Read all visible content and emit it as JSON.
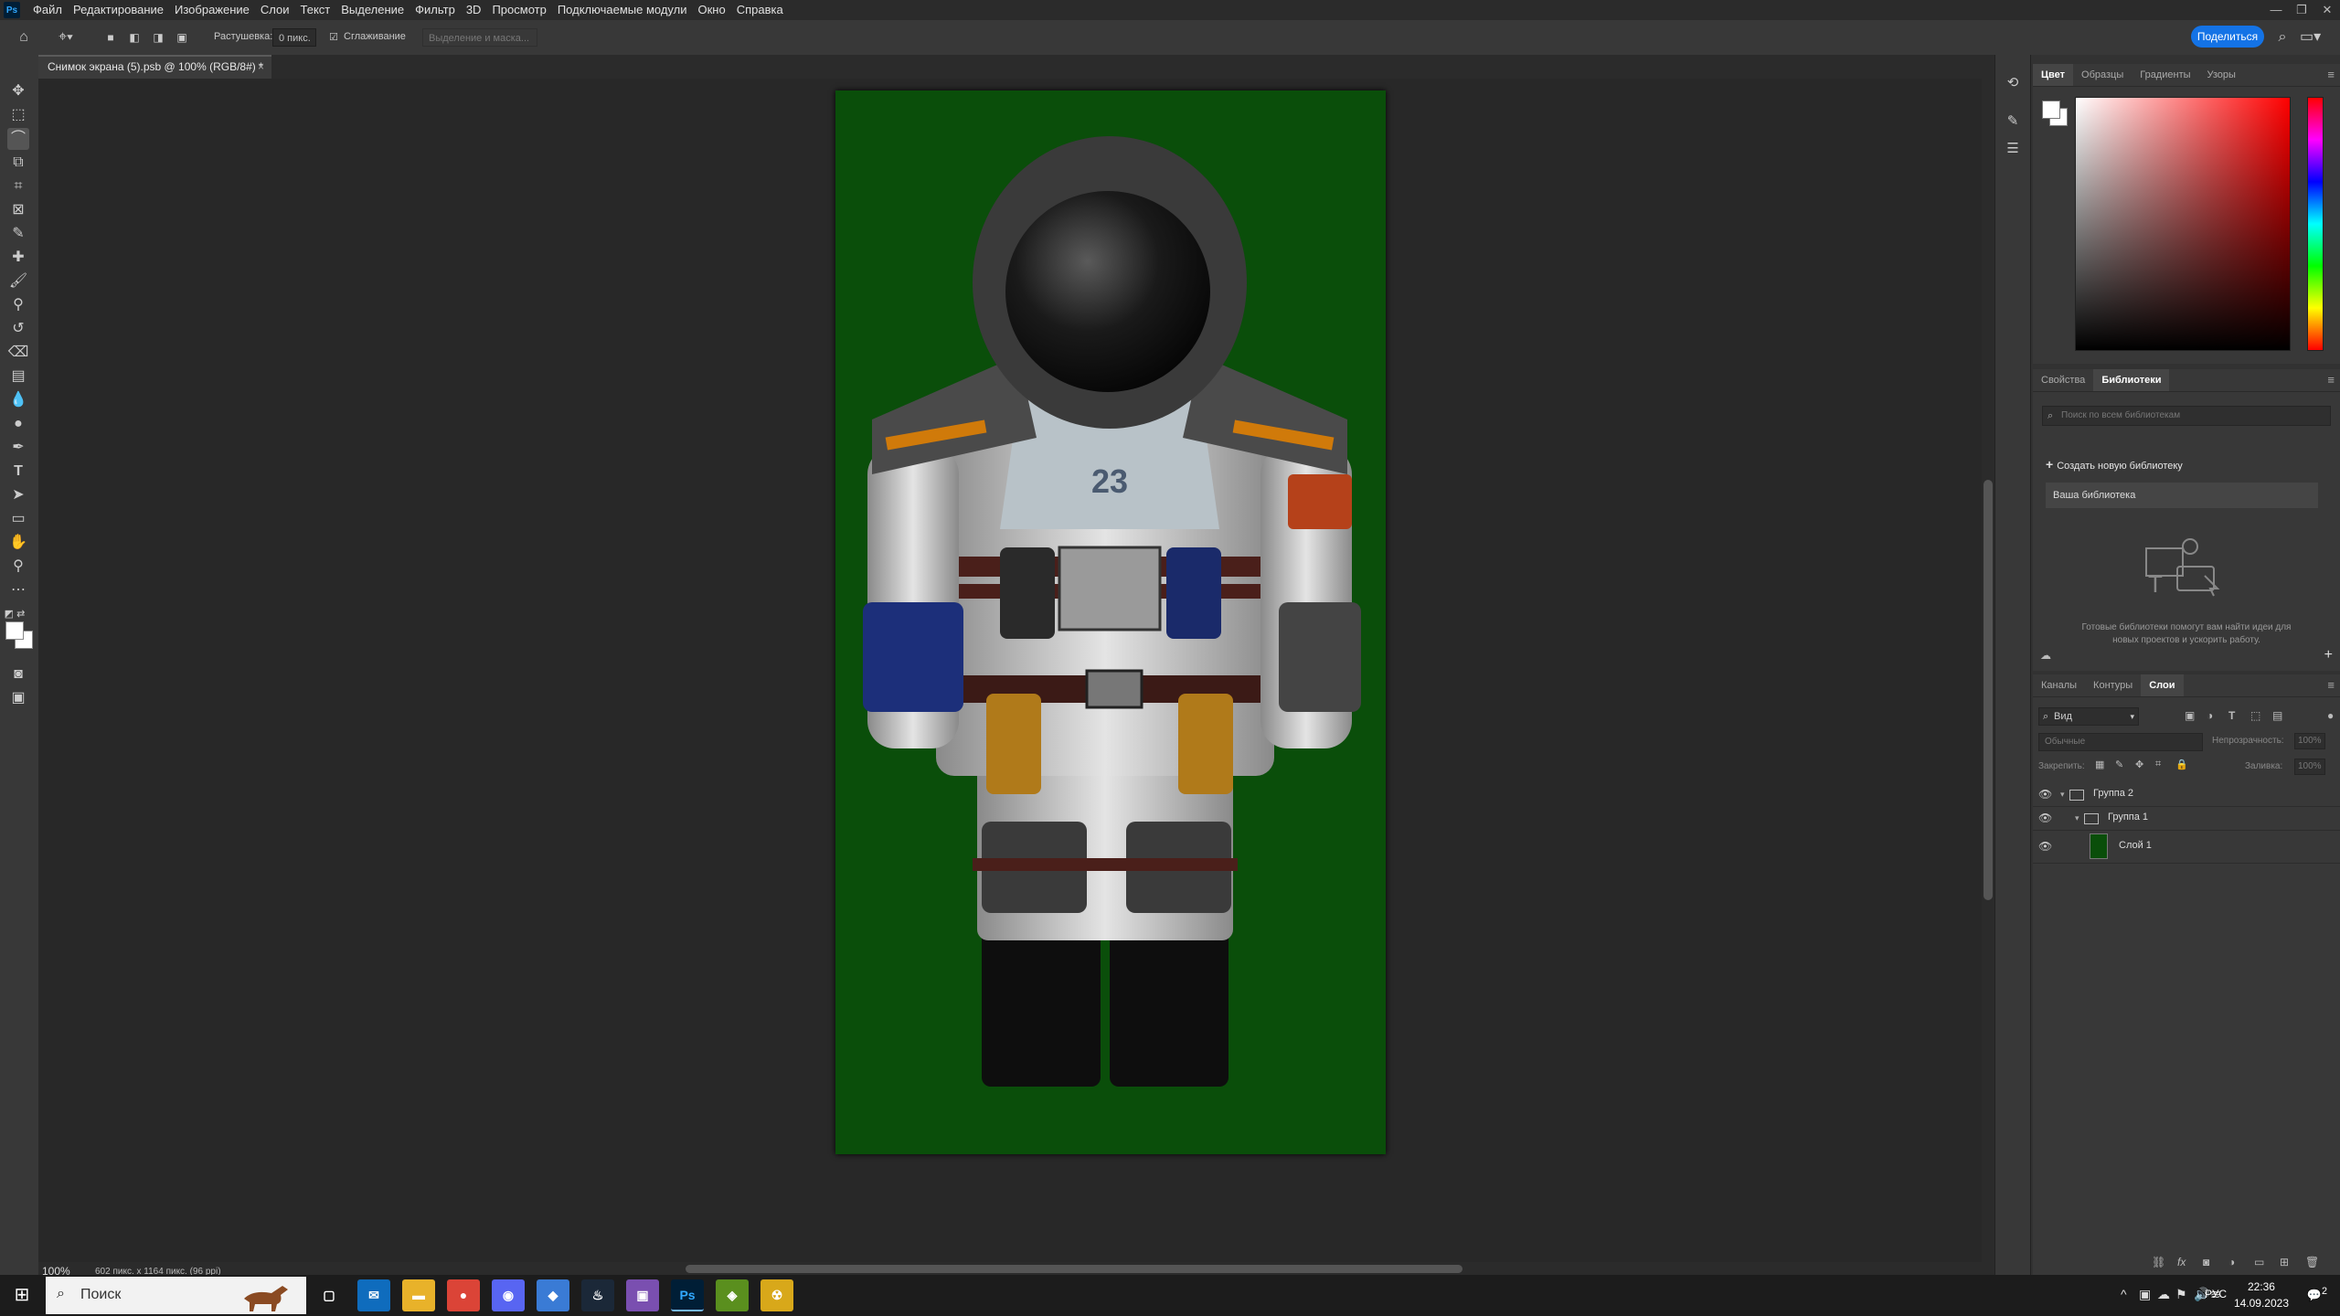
{
  "app": {
    "logo": "Ps"
  },
  "menu": [
    "Файл",
    "Редактирование",
    "Изображение",
    "Слои",
    "Текст",
    "Выделение",
    "Фильтр",
    "3D",
    "Просмотр",
    "Подключаемые модули",
    "Окно",
    "Справка"
  ],
  "window_controls": [
    "—",
    "❐",
    "✕"
  ],
  "options": {
    "feather_label": "Растушевка:",
    "feather_value": "0 пикс.",
    "antialias_label": "Сглаживание",
    "select_mask_label": "Выделение и маска...",
    "share_label": "Поделиться"
  },
  "document": {
    "tab_title": "Снимок экрана (5).psb @ 100% (RGB/8#) *",
    "close": "×",
    "zoom": "100%",
    "info": "602 пикс. x 1164 пикс. (96 ppi)",
    "chest_number": "23"
  },
  "color_panel": {
    "tabs": [
      "Цвет",
      "Образцы",
      "Градиенты",
      "Узоры"
    ],
    "active": 0
  },
  "libraries_panel": {
    "tabs": [
      "Свойства",
      "Библиотеки"
    ],
    "active": 1,
    "search_placeholder": "Поиск по всем библиотекам",
    "create_label": "Создать новую библиотеку",
    "your_library": "Ваша библиотека",
    "hint_line1": "Готовые библиотеки помогут вам найти идеи для",
    "hint_line2": "новых проектов и ускорить работу."
  },
  "layers_panel": {
    "tabs": [
      "Каналы",
      "Контуры",
      "Слои"
    ],
    "active": 2,
    "filter_label": "Вид",
    "blend_mode": "Обычные",
    "opacity_label": "Непрозрачность:",
    "opacity_value": "100%",
    "lock_label": "Закрепить:",
    "fill_label": "Заливка:",
    "fill_value": "100%",
    "layers": [
      {
        "name": "Группа 2",
        "type": "group",
        "depth": 0
      },
      {
        "name": "Группа 1",
        "type": "group",
        "depth": 1
      },
      {
        "name": "Слой 1",
        "type": "layer",
        "depth": 2
      }
    ]
  },
  "taskbar": {
    "search_placeholder": "Поиск",
    "lang": "РУС",
    "time": "22:36",
    "date": "14.09.2023",
    "notifications": "2",
    "apps": [
      {
        "name": "task-view",
        "glyph": "▢",
        "color": "#1c1c1c"
      },
      {
        "name": "mail",
        "glyph": "✉",
        "color": "#0f6cbd"
      },
      {
        "name": "explorer",
        "glyph": "▬",
        "color": "#e8b22a"
      },
      {
        "name": "chrome",
        "glyph": "●",
        "color": "#db4437"
      },
      {
        "name": "discord",
        "glyph": "◉",
        "color": "#5865f2"
      },
      {
        "name": "app-blue",
        "glyph": "◆",
        "color": "#3a7bd5"
      },
      {
        "name": "steam",
        "glyph": "♨",
        "color": "#1b2838"
      },
      {
        "name": "app-color",
        "glyph": "▣",
        "color": "#7a4fb0"
      },
      {
        "name": "photoshop",
        "glyph": "Ps",
        "color": "#001e36"
      },
      {
        "name": "store-bag",
        "glyph": "◈",
        "color": "#5a8f1e"
      },
      {
        "name": "radiation-app",
        "glyph": "☢",
        "color": "#d8a81a"
      }
    ]
  },
  "colors": {
    "accent": "#1473e6",
    "canvas_bg": "#0a4e0a"
  }
}
